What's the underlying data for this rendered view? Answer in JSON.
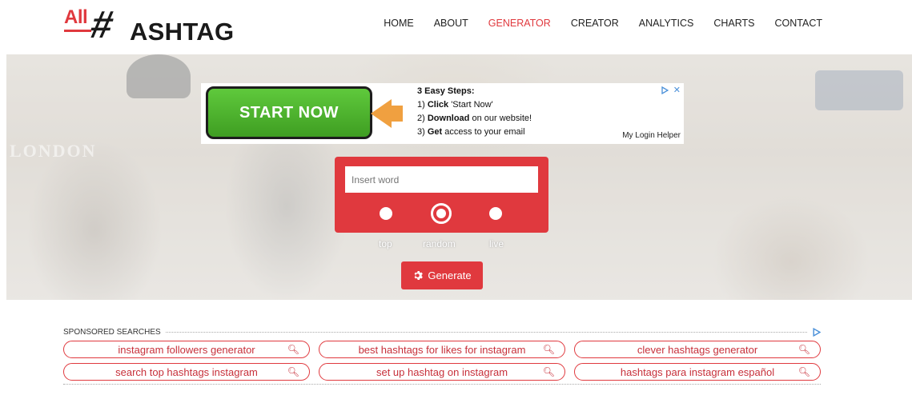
{
  "logo": {
    "all": "All",
    "hash": "#",
    "rest": "ASHTAG"
  },
  "nav": [
    "HOME",
    "ABOUT",
    "GENERATOR",
    "CREATOR",
    "ANALYTICS",
    "CHARTS",
    "CONTACT"
  ],
  "nav_active": "GENERATOR",
  "hero": {
    "bg_text": "LONDON"
  },
  "ad": {
    "button": "START NOW",
    "steps_title": "3 Easy Steps:",
    "step1_num": "1)",
    "step1_bold": "Click",
    "step1_rest": "'Start Now'",
    "step2_num": "2)",
    "step2_bold": "Download",
    "step2_rest": "on our website!",
    "step3_num": "3)",
    "step3_bold": "Get",
    "step3_rest": "access to your email",
    "helper": "My Login Helper",
    "choices_icon": "adchoices-icon",
    "close": "✕"
  },
  "search": {
    "placeholder": "Insert word",
    "options": [
      "top",
      "random",
      "live"
    ],
    "selected": "random"
  },
  "generate_label": "Generate",
  "sponsored": {
    "title": "SPONSORED SEARCHES",
    "items": [
      "instagram followers generator",
      "best hashtags for likes for instagram",
      "clever hashtags generator",
      "search top hashtags instagram",
      "set up hashtag on instagram",
      "hashtags para instagram español"
    ]
  },
  "colors": {
    "accent": "#e0393e",
    "ad_green": "#4fb52e"
  }
}
